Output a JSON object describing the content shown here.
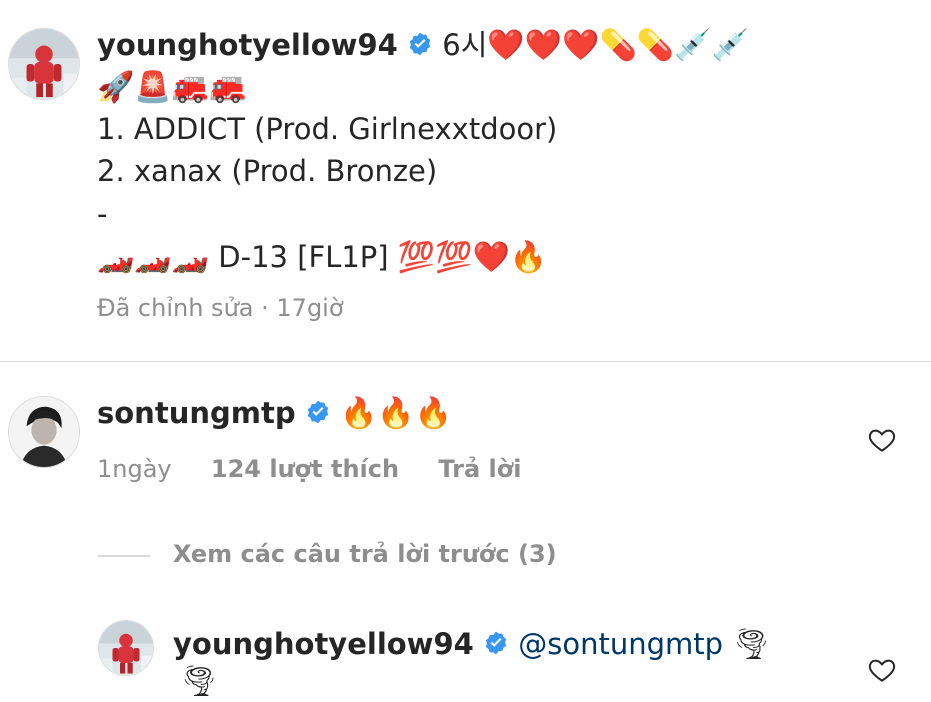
{
  "post": {
    "username": "younghotyellow94",
    "caption_inline": "6시",
    "caption_emoji_line1": "❤️❤️❤️💊💊💉💉",
    "caption_emoji_line2": "🚀🚨🚒🚒",
    "track_1": "1. ADDICT (Prod. Girlnexxtdoor)",
    "track_2": "2. xanax (Prod. Bronze)",
    "dash": "-",
    "countdown_prefix": "🏎️🏎️🏎️",
    "countdown_text": "D-13 [FL1P]",
    "countdown_suffix": "💯💯❤️🔥",
    "edited_label": "Đã chỉnh sửa",
    "separator": "·",
    "time_ago": "17giờ"
  },
  "comment": {
    "username": "sontungmtp",
    "text": "🔥🔥🔥",
    "time_ago": "1ngày",
    "likes": "124 lượt thích",
    "reply_label": "Trả lời"
  },
  "view_replies": {
    "label": "Xem các câu trả lời trước (3)"
  },
  "reply": {
    "username": "younghotyellow94",
    "mention": "@sontungmtp",
    "text_emoji": "🌪",
    "text_emoji_wrap": "🌪"
  },
  "colors": {
    "verified": "#3897f0",
    "meta": "#8e8e8e",
    "divider": "#dbdbdb",
    "mention": "#00376b"
  }
}
